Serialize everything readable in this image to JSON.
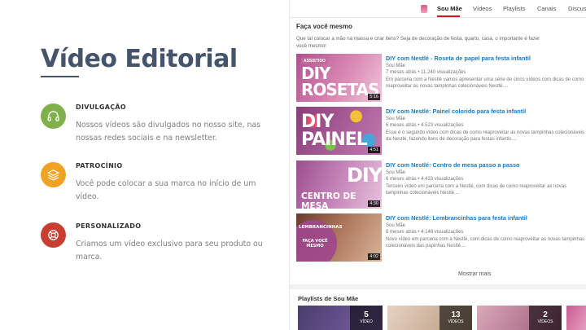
{
  "title": "Vídeo Editorial",
  "features": [
    {
      "heading": "DIVULGAÇÃO",
      "text": "Nossos vídeos são divulgados no nosso site, nas nossas redes sociais e na newsletter.",
      "icon": "headphones-icon",
      "color": "#7fb04a"
    },
    {
      "heading": "PATROCÍNIO",
      "text": "Você pode colocar a sua marca no início de um vídeo.",
      "icon": "layers-icon",
      "color": "#f0a224"
    },
    {
      "heading": "PERSONALIZADO",
      "text": "Criamos um vídeo exclusivo para seu produto ou marca.",
      "icon": "lifebuoy-icon",
      "color": "#c83f32"
    }
  ],
  "channel": {
    "tabs": [
      "Sou Mãe",
      "Vídeos",
      "Playlists",
      "Canais",
      "Discuss"
    ],
    "active_tab": "Sou Mãe",
    "section_title": "Faça você mesmo",
    "section_desc": "Que tal colocar a mão na massa e criar itens? Seja de decoração de festa, quarto, casa, o importante é fazer você mesmo!",
    "videos": [
      {
        "title": "DIY com Nestlé - Roseta de papel para festa infantil",
        "channel": "Sou Mãe",
        "meta": "7 meses atrás • 11.240 visualizações",
        "desc": "Em parceria com a Nestlé vamos apresentar uma série de cinco vídeos com dicas de como reaproveitar as novas tampinhas colecionáveis Nestlé....",
        "thumb_tag": "ASSISTIDO",
        "thumb_line1": "DIY",
        "thumb_line2": "ROSETAS",
        "duration": "5:16"
      },
      {
        "title": "DIY com Nestlé: Painel colorido para festa infantil",
        "channel": "Sou Mãe",
        "meta": "6 meses atrás • 4.523 visualizações",
        "desc": "Esse é o segundo vídeo com dicas de como reaproveitar as novas tampinhas colecionáveis da Nestlé, fazendo itens de decoração para festas infantis....",
        "thumb_line1": "DIY",
        "thumb_line2": "PAINEL",
        "duration": "4:51"
      },
      {
        "title": "DIY com Nestlé: Centro de mesa passo a passo",
        "channel": "Sou Mãe",
        "meta": "6 meses atrás • 4.433 visualizações",
        "desc": "Terceiro vídeo em parceria com a Nestlé, com dicas de como reaproveitar as novas tampinhas colecionáveis Nestlé....",
        "thumb_line1": "DIY",
        "thumb_line2": "CENTRO DE MESA",
        "duration": "4:30"
      },
      {
        "title": "DIY com Nestlé: Lembrancinhas para festa infantil",
        "channel": "Sou Mãe",
        "meta": "6 meses atrás • 4.148 visualizações",
        "desc": "Novo vídeo em parceria com a Nestlé, com dicas de como reaproveitar as novas tampinhas colecionáveis das papinhas Nestlé....",
        "thumb_line1": "LEMBRANCINHAS",
        "thumb_line2": "FAÇA VOCÊ MESMO",
        "duration": "4:02"
      }
    ],
    "show_more": "Mostrar mais",
    "playlists_title": "Playlists de Sou Mãe",
    "playlists": [
      {
        "count": "5",
        "label": "VÍDEO"
      },
      {
        "count": "13",
        "label": "VÍDEOS"
      },
      {
        "count": "2",
        "label": "VÍDEOS"
      },
      {
        "count": "",
        "label": ""
      }
    ]
  }
}
